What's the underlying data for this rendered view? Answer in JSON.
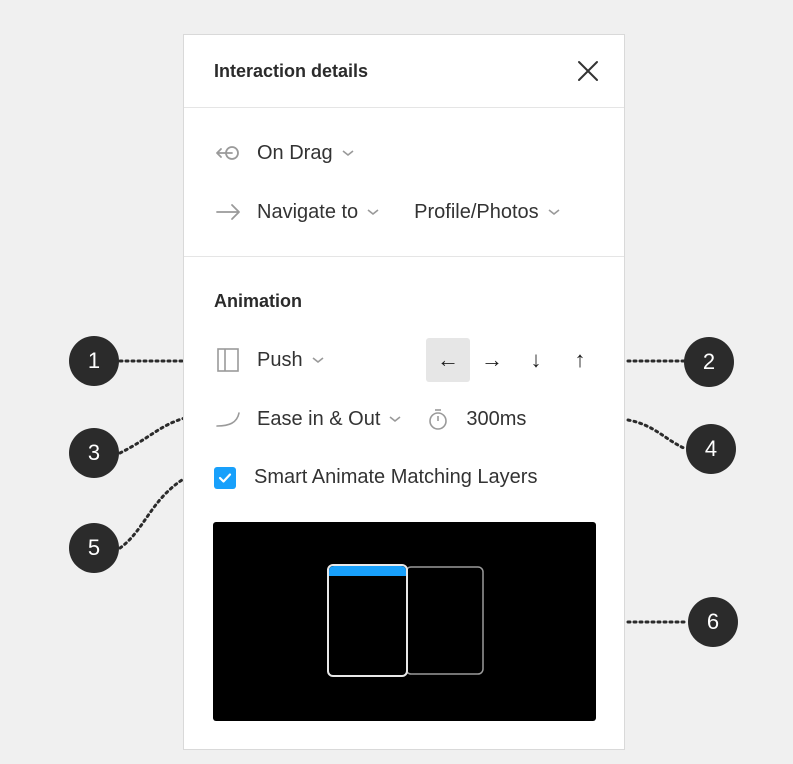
{
  "panel": {
    "title": "Interaction details",
    "trigger": {
      "label": "On Drag"
    },
    "action": {
      "label": "Navigate to",
      "destination": "Profile/Photos"
    },
    "animation": {
      "section_title": "Animation",
      "type_label": "Push",
      "directions": [
        {
          "symbol": "←",
          "active": true
        },
        {
          "symbol": "→",
          "active": false
        },
        {
          "symbol": "↓",
          "active": false
        },
        {
          "symbol": "↑",
          "active": false
        }
      ],
      "easing_label": "Ease in & Out",
      "duration": "300ms",
      "smart_animate": {
        "label": "Smart Animate Matching Layers",
        "checked": true
      }
    }
  },
  "callouts": [
    "1",
    "2",
    "3",
    "4",
    "5",
    "6"
  ],
  "colors": {
    "accent": "#18a0fb",
    "preview_bg": "#000000",
    "callout_bg": "#2b2b2b",
    "page_bg": "#f0f0f0"
  },
  "icons": {
    "close": "close-icon",
    "trigger": "drag-icon",
    "action": "arrow-right-icon",
    "animation_type": "push-icon",
    "easing": "ease-curve-icon",
    "duration": "timer-icon",
    "checkbox": "checkmark-icon"
  }
}
